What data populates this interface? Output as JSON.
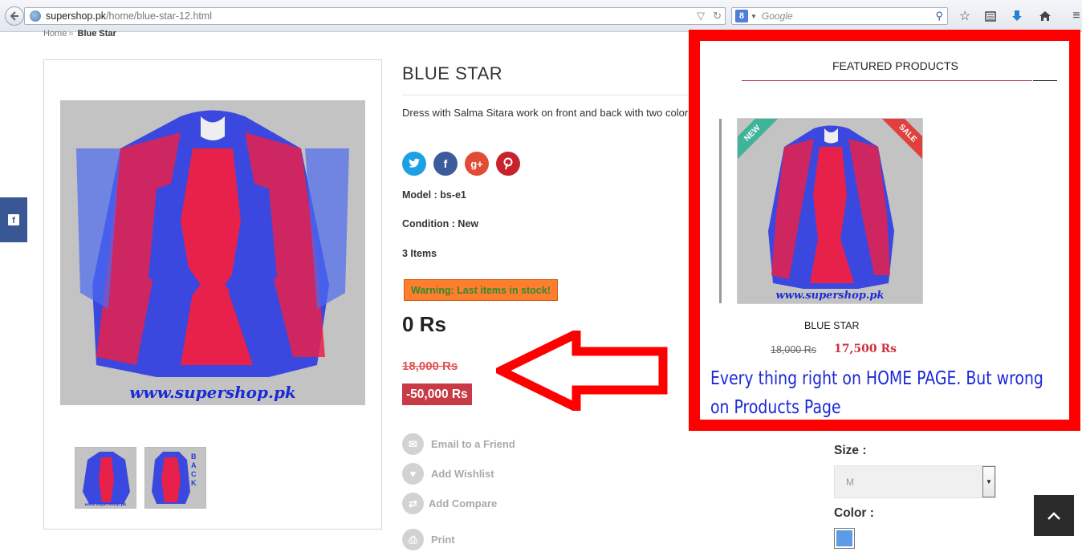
{
  "browser": {
    "url_domain": "supershop.pk",
    "url_path": "/home/blue-star-12.html",
    "search_placeholder": "Google",
    "search_engine_letter": "8"
  },
  "breadcrumb": {
    "home": "Home",
    "separator": "»",
    "current": "Blue Star"
  },
  "product": {
    "title": "BLUE STAR",
    "description": "Dress with Salma Sitara work on front and back with two color comb",
    "model": "Model : bs-e1",
    "condition": "Condition : New",
    "items": "3 Items",
    "warning": "Warning: Last items in stock!",
    "price": "0 Rs",
    "old_price": "18,000 Rs",
    "reduction": "-50,000 Rs",
    "watermark": "www.supershop.pk",
    "thumb_watermark": "www.supershop.pk",
    "thumb_back_text": "BACK"
  },
  "social": [
    {
      "name": "twitter",
      "glyph": "t",
      "color": "#1da1e2"
    },
    {
      "name": "facebook",
      "glyph": "f",
      "color": "#3b5b9a"
    },
    {
      "name": "google-plus",
      "glyph": "g+",
      "color": "#e24b35"
    },
    {
      "name": "pinterest",
      "glyph": "p",
      "color": "#c8232c"
    }
  ],
  "actions": {
    "email": "Email to a Friend",
    "wishlist": "Add Wishlist",
    "compare": "Add Compare",
    "print": "Print"
  },
  "featured": {
    "title": "FEATURED PRODUCTS",
    "new_label": "NEW",
    "sale_label": "SALE",
    "product_name": "BLUE STAR",
    "old_price": "18,000 Rs",
    "new_price": "17,500 Rs",
    "watermark": "www.supershop.pk"
  },
  "annotation": {
    "line1": "Every thing right on HOME PAGE. But wrong",
    "line2": "on Products Page"
  },
  "options": {
    "size_label": "Size :",
    "size_value": "M",
    "color_label": "Color :",
    "color_value": "#5b9be8"
  },
  "colors": {
    "annotation_frame": "#ff0000",
    "arrow": "#ff0000",
    "warning_bg": "#fe7e2e",
    "reduction_bg": "#c83a45"
  }
}
